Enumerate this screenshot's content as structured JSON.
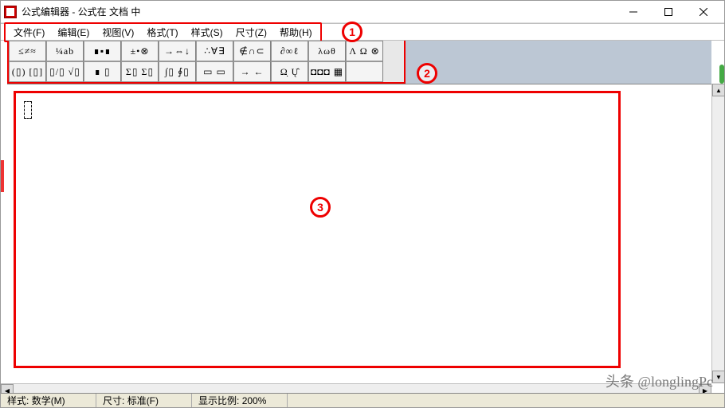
{
  "titlebar": {
    "title": "公式编辑器 - 公式在 文档 中"
  },
  "menu": {
    "items": [
      "文件(F)",
      "编辑(E)",
      "视图(V)",
      "格式(T)",
      "样式(S)",
      "尺寸(Z)",
      "帮助(H)"
    ]
  },
  "toolbar": {
    "row1": [
      "≤≠≈",
      "¼ab",
      "∎▪∎",
      "±•⊗",
      "→⇔↓",
      "∴∀∃",
      "∉∩⊂",
      "∂∞ℓ",
      "λωθ",
      "Λ Ω ⊗"
    ],
    "row2": [
      "(▯) [▯]",
      "▯/▯ √▯",
      "∎ ▯",
      "Σ▯ Σ▯",
      "∫▯ ∮▯",
      "▭ ▭",
      "→ ←",
      "Ω̣ Ų̂",
      "◘◘◘ ▦",
      ""
    ]
  },
  "statusbar": {
    "style_label": "样式:",
    "style_value": "数学(M)",
    "size_label": "尺寸:",
    "size_value": "标准(F)",
    "zoom_label": "显示比例:",
    "zoom_value": "200%"
  },
  "annotations": {
    "one": "1",
    "two": "2",
    "three": "3"
  },
  "watermark": "头条 @longlingPc"
}
